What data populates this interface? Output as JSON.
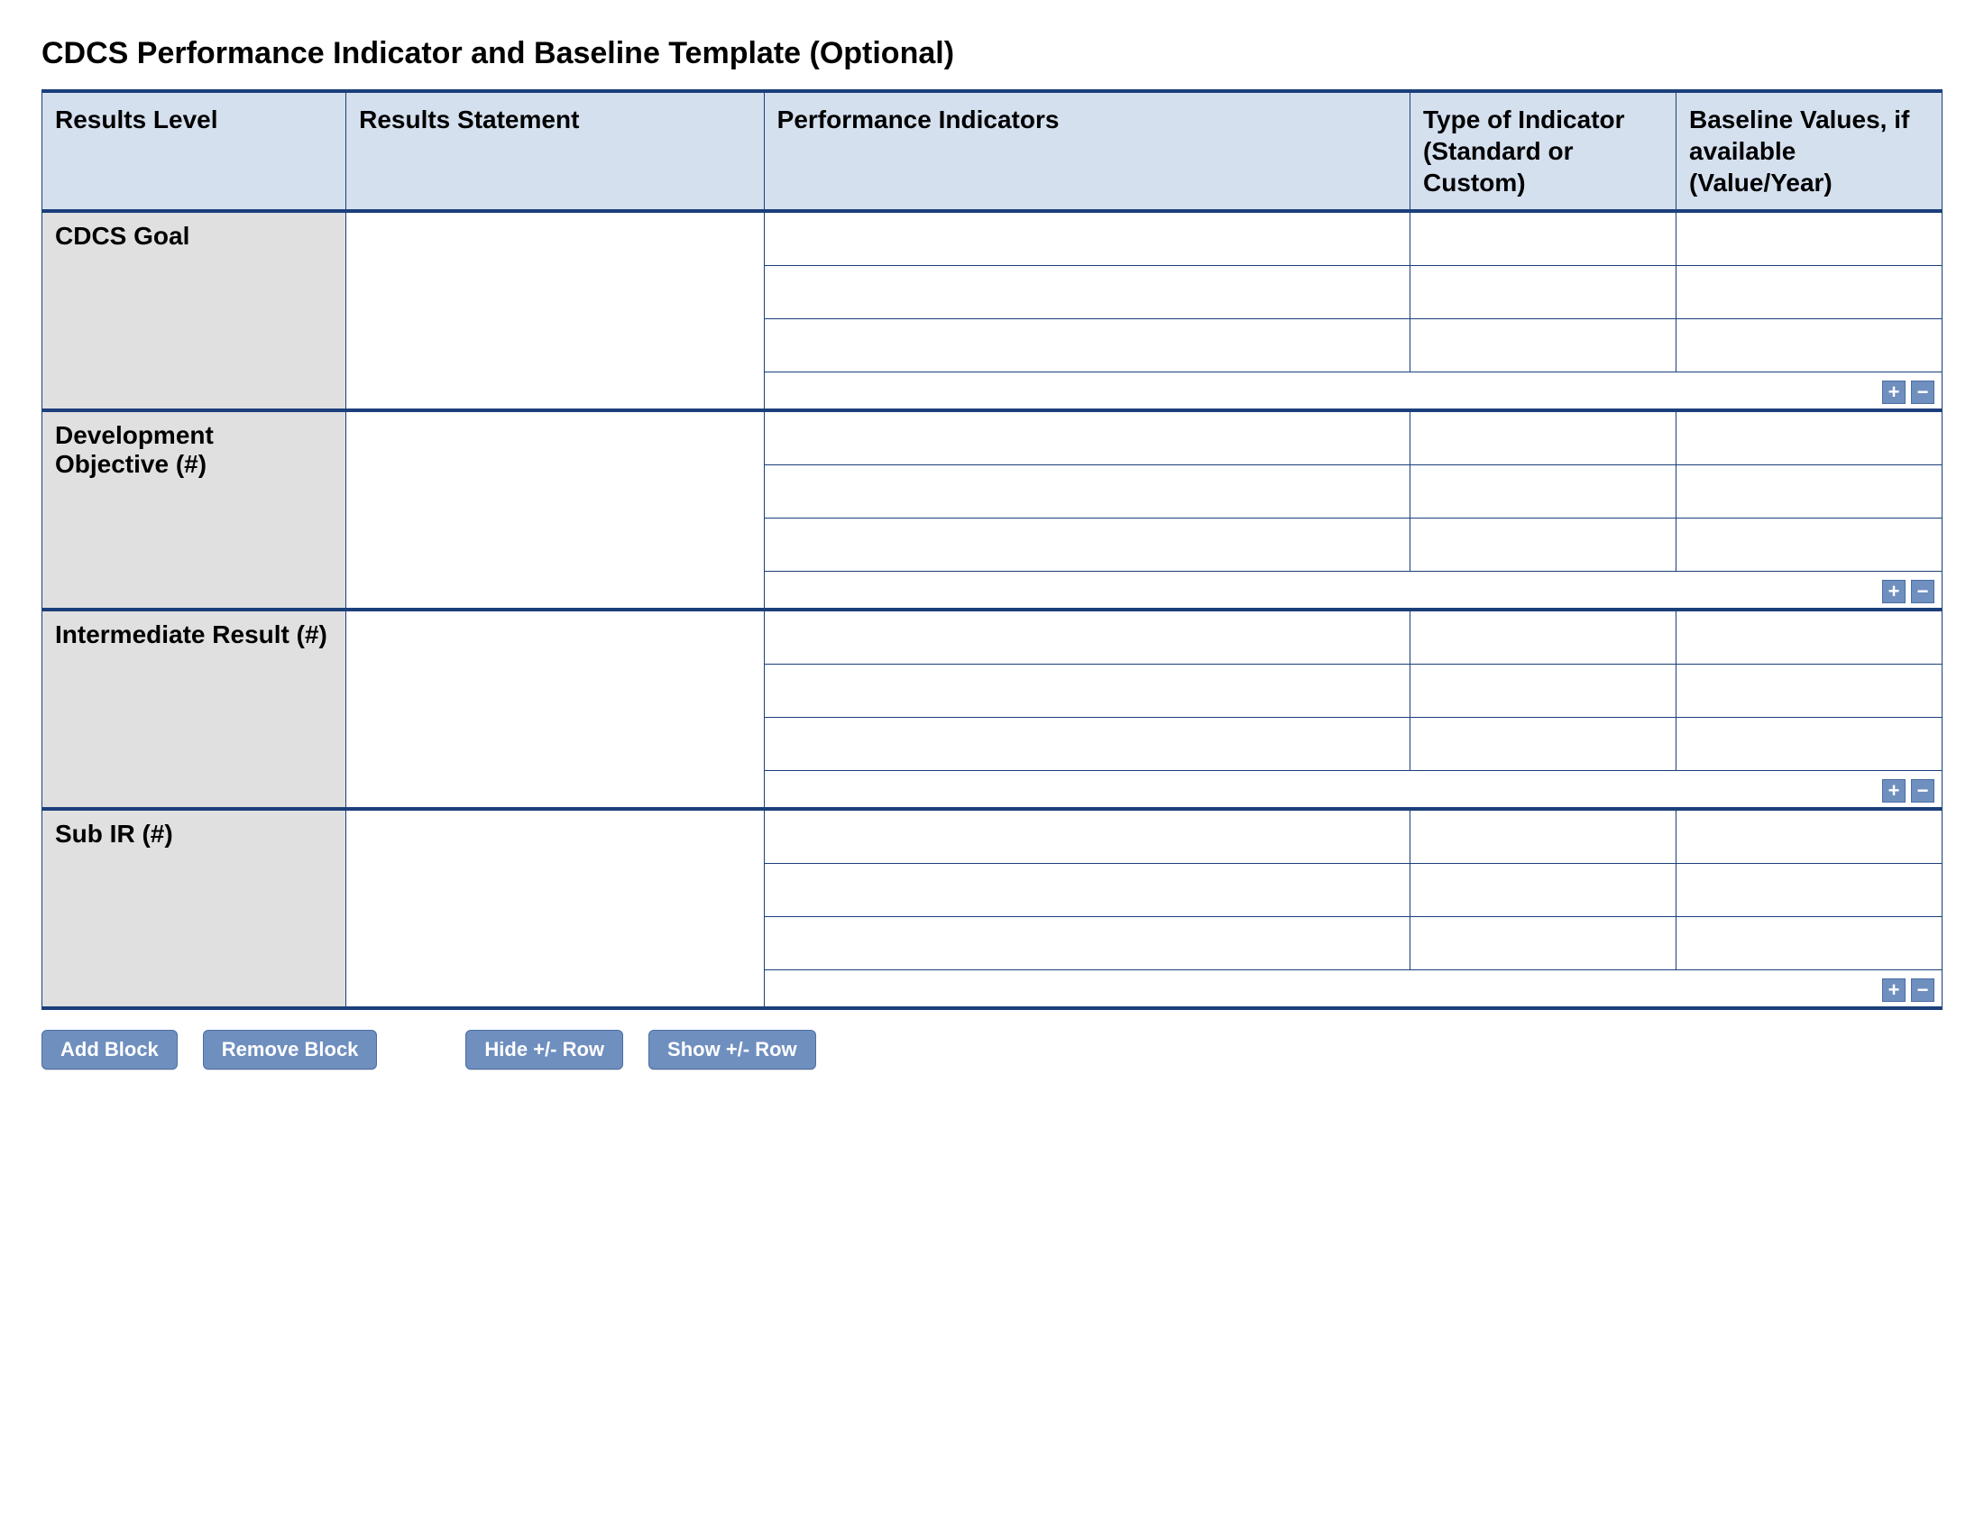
{
  "title": "CDCS Performance Indicator and Baseline Template (Optional)",
  "headers": {
    "results_level": "Results Level",
    "results_statement": "Results Statement",
    "performance_indicators": "Performance Indicators",
    "type_of_indicator": "Type of Indicator (Standard or Custom)",
    "baseline_values": "Baseline Values, if available (Value/Year)"
  },
  "sections": [
    {
      "level_label": "CDCS Goal",
      "results_statement": "",
      "rows": [
        {
          "indicator": "",
          "type": "",
          "baseline": ""
        },
        {
          "indicator": "",
          "type": "",
          "baseline": ""
        },
        {
          "indicator": "",
          "type": "",
          "baseline": ""
        }
      ]
    },
    {
      "level_label": "Development Objective (#)",
      "results_statement": "",
      "rows": [
        {
          "indicator": "",
          "type": "",
          "baseline": ""
        },
        {
          "indicator": "",
          "type": "",
          "baseline": ""
        },
        {
          "indicator": "",
          "type": "",
          "baseline": ""
        }
      ]
    },
    {
      "level_label": "Intermediate Result (#)",
      "results_statement": "",
      "rows": [
        {
          "indicator": "",
          "type": "",
          "baseline": ""
        },
        {
          "indicator": "",
          "type": "",
          "baseline": ""
        },
        {
          "indicator": "",
          "type": "",
          "baseline": ""
        }
      ]
    },
    {
      "level_label": "Sub IR (#)",
      "results_statement": "",
      "rows": [
        {
          "indicator": "",
          "type": "",
          "baseline": ""
        },
        {
          "indicator": "",
          "type": "",
          "baseline": ""
        },
        {
          "indicator": "",
          "type": "",
          "baseline": ""
        }
      ]
    }
  ],
  "row_controls": {
    "add": "+",
    "remove": "−"
  },
  "buttons": {
    "add_block": "Add Block",
    "remove_block": "Remove Block",
    "hide_row": "Hide +/- Row",
    "show_row": "Show +/- Row"
  }
}
